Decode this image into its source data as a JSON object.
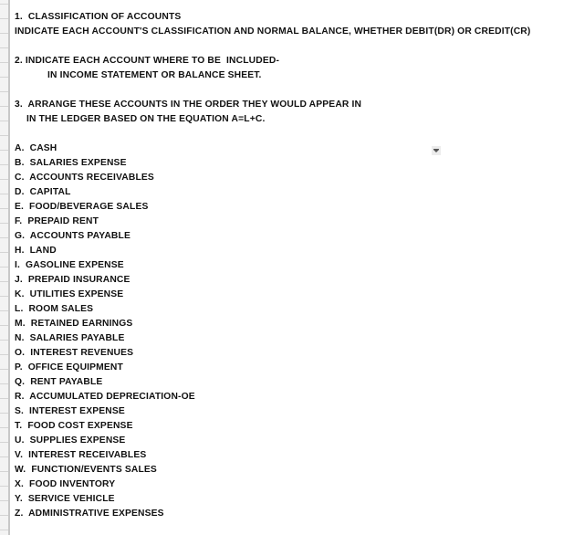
{
  "instructions": {
    "q1_title": "1.  CLASSIFICATION OF ACCOUNTS",
    "q1_detail": "INDICATE EACH ACCOUNT'S CLASSIFICATION AND NORMAL BALANCE, WHETHER DEBIT(DR) OR CREDIT(CR)",
    "q2_line1": "2. INDICATE EACH ACCOUNT WHERE TO BE  INCLUDED-",
    "q2_line2": "IN INCOME STATEMENT OR BALANCE SHEET.",
    "q3_line1": "3.  ARRANGE THESE ACCOUNTS IN THE ORDER THEY WOULD APPEAR IN",
    "q3_line2": "IN THE LEDGER BASED ON THE EQUATION A=L+C."
  },
  "filter_button": {
    "icon": "filter-dropdown-icon"
  },
  "accounts": [
    "A.  CASH",
    "B.  SALARIES EXPENSE",
    "C.  ACCOUNTS RECEIVABLES",
    "D.  CAPITAL",
    "E.  FOOD/BEVERAGE SALES",
    "F.  PREPAID RENT",
    "G.  ACCOUNTS PAYABLE",
    "H.  LAND",
    "I.  GASOLINE EXPENSE",
    "J.  PREPAID INSURANCE",
    "K.  UTILITIES EXPENSE",
    "L.  ROOM SALES",
    "M.  RETAINED EARNINGS",
    "N.  SALARIES PAYABLE",
    "O.  INTEREST REVENUES",
    "P.  OFFICE EQUIPMENT",
    "Q.  RENT PAYABLE",
    "R.  ACCUMULATED DEPRECIATION-OE",
    "S.  INTEREST EXPENSE",
    "T.  FOOD COST EXPENSE",
    "U.  SUPPLIES EXPENSE",
    "V.  INTEREST RECEIVABLES",
    "W.  FUNCTION/EVENTS SALES",
    "X.  FOOD INVENTORY",
    "Y.  SERVICE VEHICLE",
    "Z.  ADMINISTRATIVE EXPENSES"
  ]
}
